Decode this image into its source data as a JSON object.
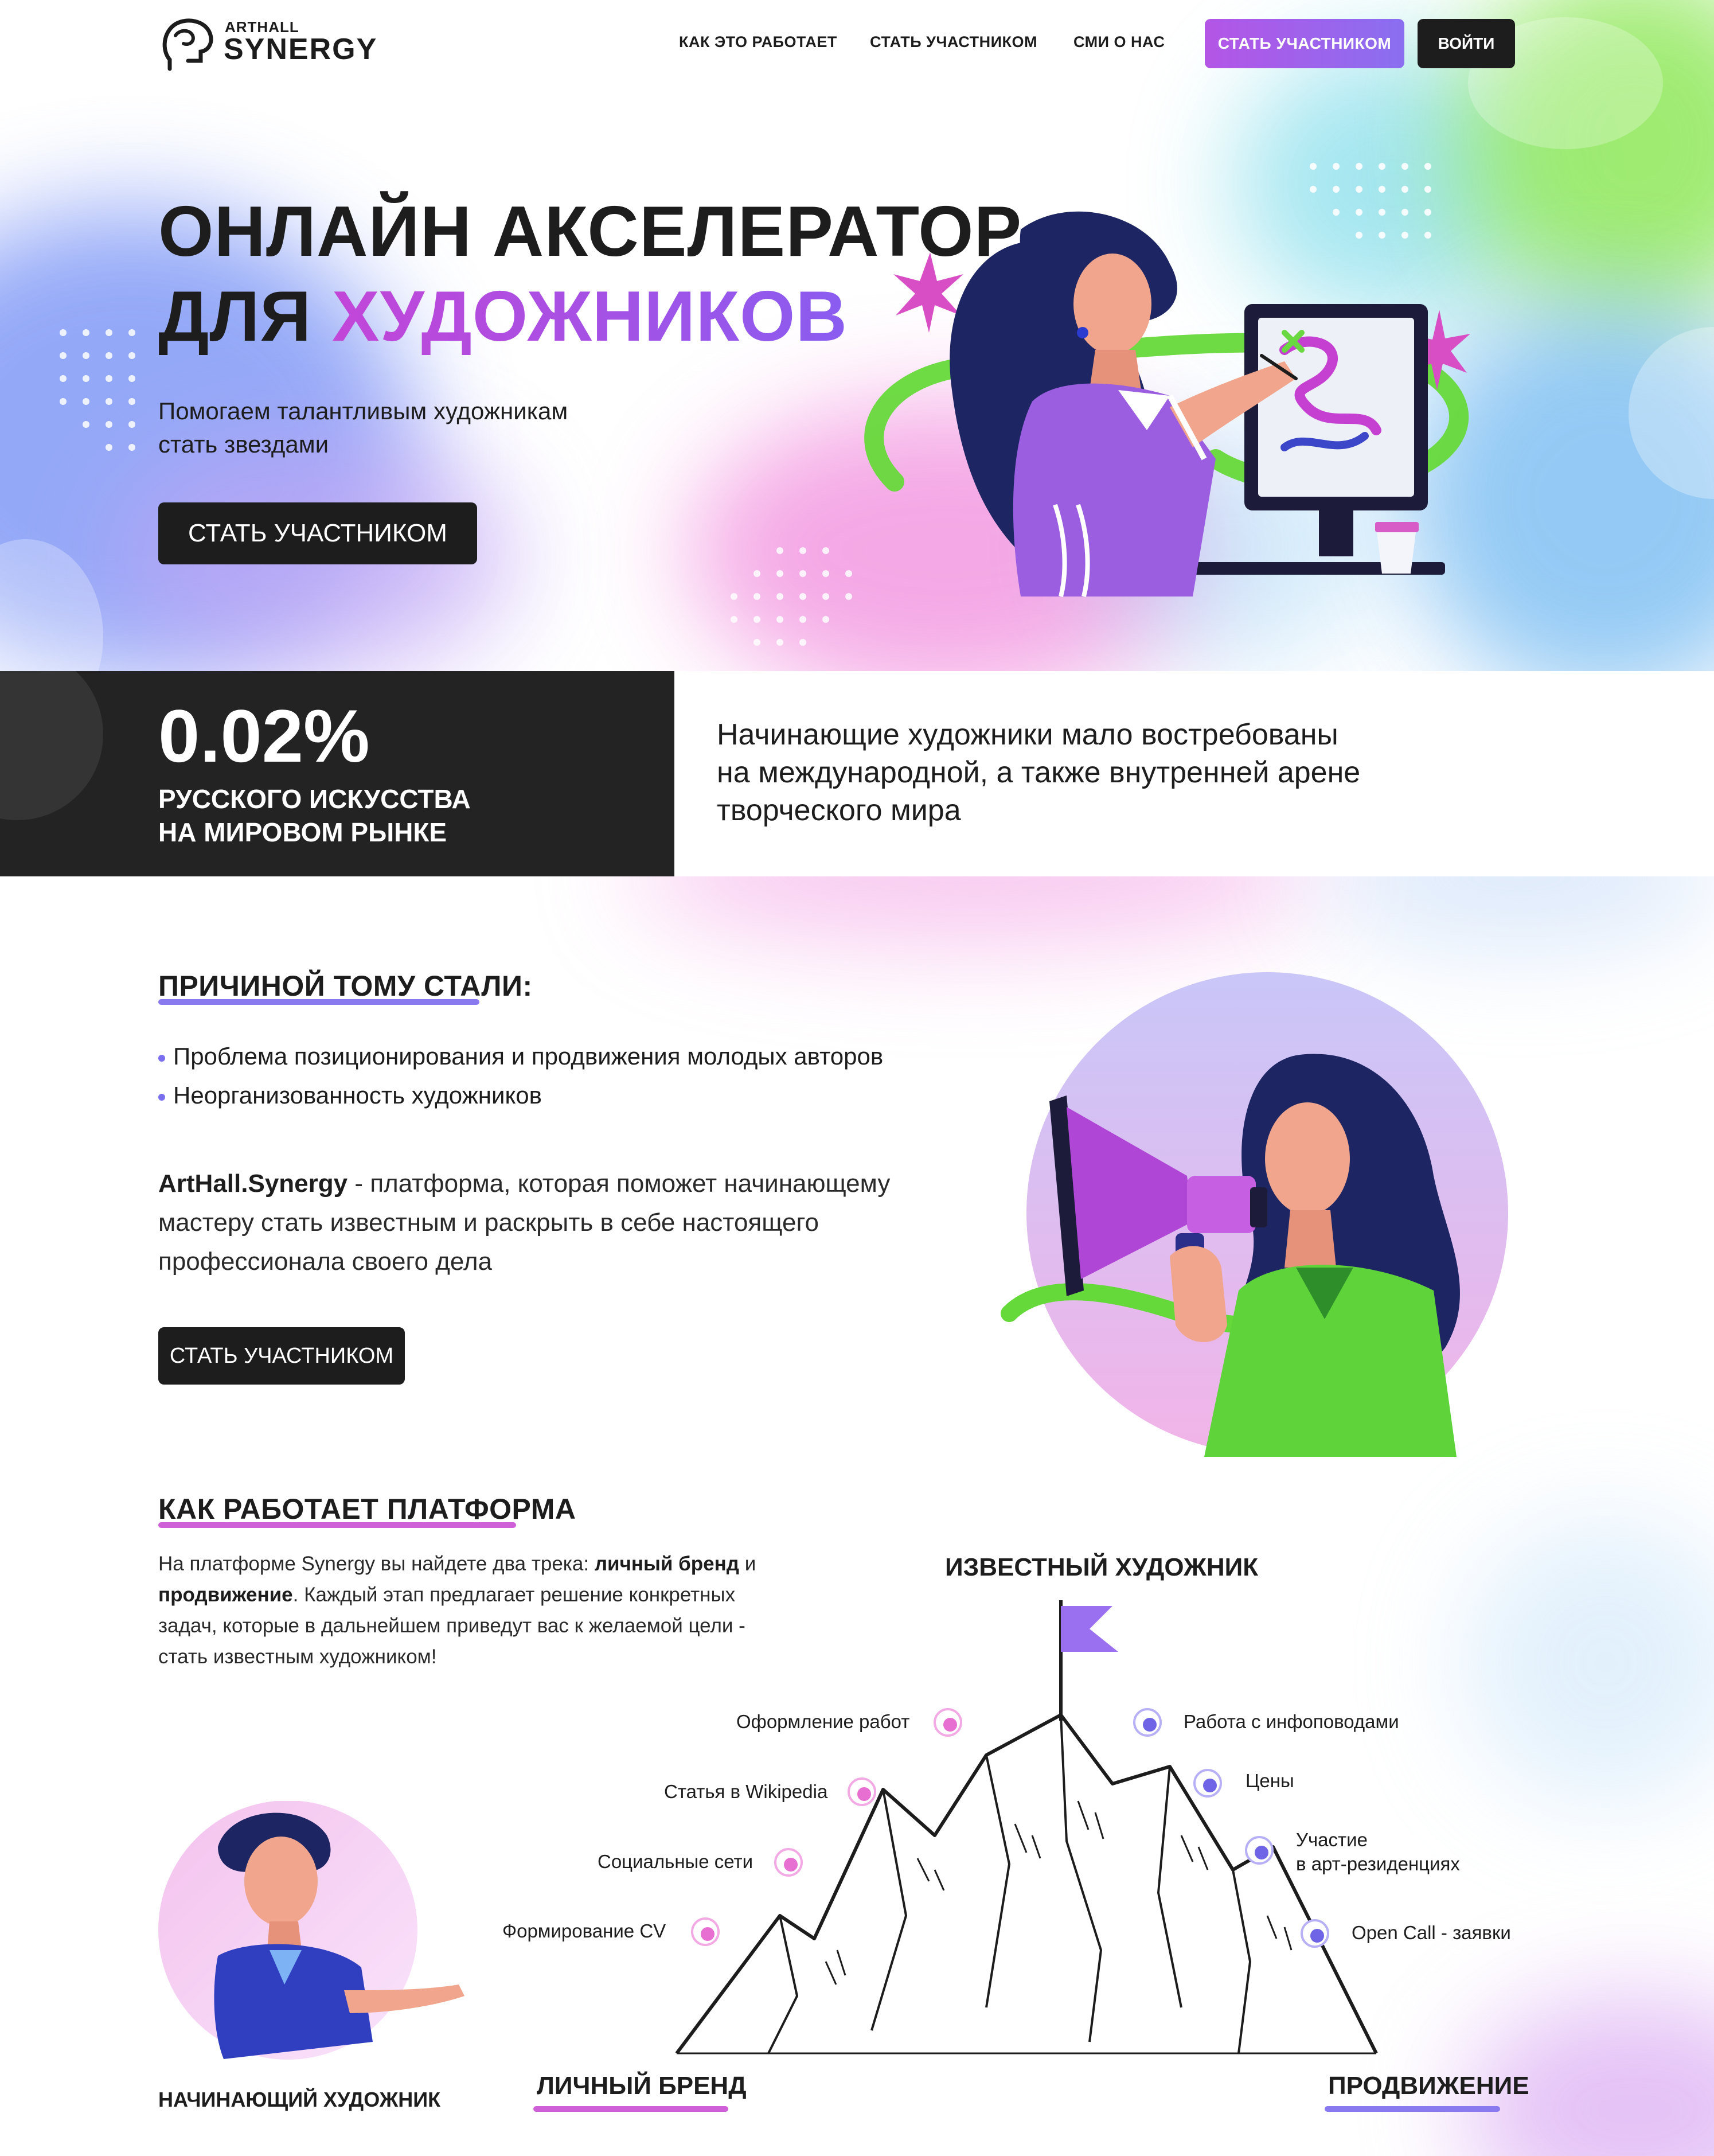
{
  "header": {
    "logo_top": "ARTHALL",
    "logo_main": "SYNERGY",
    "nav": [
      "КАК ЭТО РАБОТАЕТ",
      "СТАТЬ УЧАСТНИКОМ",
      "СМИ О НАС"
    ],
    "cta_button": "СТАТЬ УЧАСТНИКОМ",
    "login_button": "ВОЙТИ"
  },
  "hero": {
    "title_line1": "ОНЛАЙН АКСЕЛЕРАТОР",
    "title_line2_prefix": "ДЛЯ ",
    "title_line2_accent": "ХУДОЖНИКОВ",
    "subtitle_line1": "Помогаем талантливым художникам",
    "subtitle_line2": "стать звездами",
    "button": "СТАТЬ УЧАСТНИКОМ"
  },
  "stats": {
    "number": "0.02%",
    "label_line1": "РУССКОГО ИСКУССТВА",
    "label_line2": "НА МИРОВОМ РЫНКЕ",
    "text_line1": "Начинающие художники мало востребованы",
    "text_line2": "на международной, а также внутренней арене",
    "text_line3": "творческого мира"
  },
  "reasons": {
    "title": "ПРИЧИНОЙ ТОМУ СТАЛИ:",
    "items": [
      "Проблема позиционирования и продвижения молодых авторов",
      "Неорганизованность художников"
    ],
    "brand": "ArtHall.Synergy",
    "description": " - платформа, которая поможет начинающему мастеру стать известным и раскрыть в себе настоящего профессионала своего дела",
    "button": "СТАТЬ УЧАСТНИКОМ"
  },
  "platform": {
    "title": "КАК РАБОТАЕТ ПЛАТФОРМА",
    "text_part1": "На платформе Synergy вы найдете два трека: ",
    "text_bold1": "личный бренд",
    "text_part2": " и ",
    "text_bold2": "продвижение",
    "text_part3": ". Каждый этап предлагает решение конкретных задач, которые в дальнейшем приведут вас к желаемой цели - стать известным художником!",
    "goal": "ИЗВЕСТНЫЙ ХУДОЖНИК",
    "brand_steps": [
      "Оформление работ",
      "Статья в Wikipedia",
      "Социальные сети",
      "Формирование CV"
    ],
    "promo_steps": [
      "Работа с инфоповодами",
      "Цены",
      "Участие\nв арт-резиденциях",
      "Open Call - заявки"
    ],
    "beginner": "НАЧИНАЮЩИЙ ХУДОЖНИК",
    "track_brand": "ЛИЧНЫЙ БРЕНД",
    "track_promo": "ПРОДВИЖЕНИЕ"
  },
  "colors": {
    "accent_violet": "#7a6ff0",
    "accent_pink": "#e76fd1",
    "dark": "#1d1d1d",
    "green": "#5fd43a"
  },
  "icons": [
    "logo-head-icon",
    "star-burst-icon",
    "flag-icon",
    "megaphone-icon",
    "step-marker-icon"
  ]
}
